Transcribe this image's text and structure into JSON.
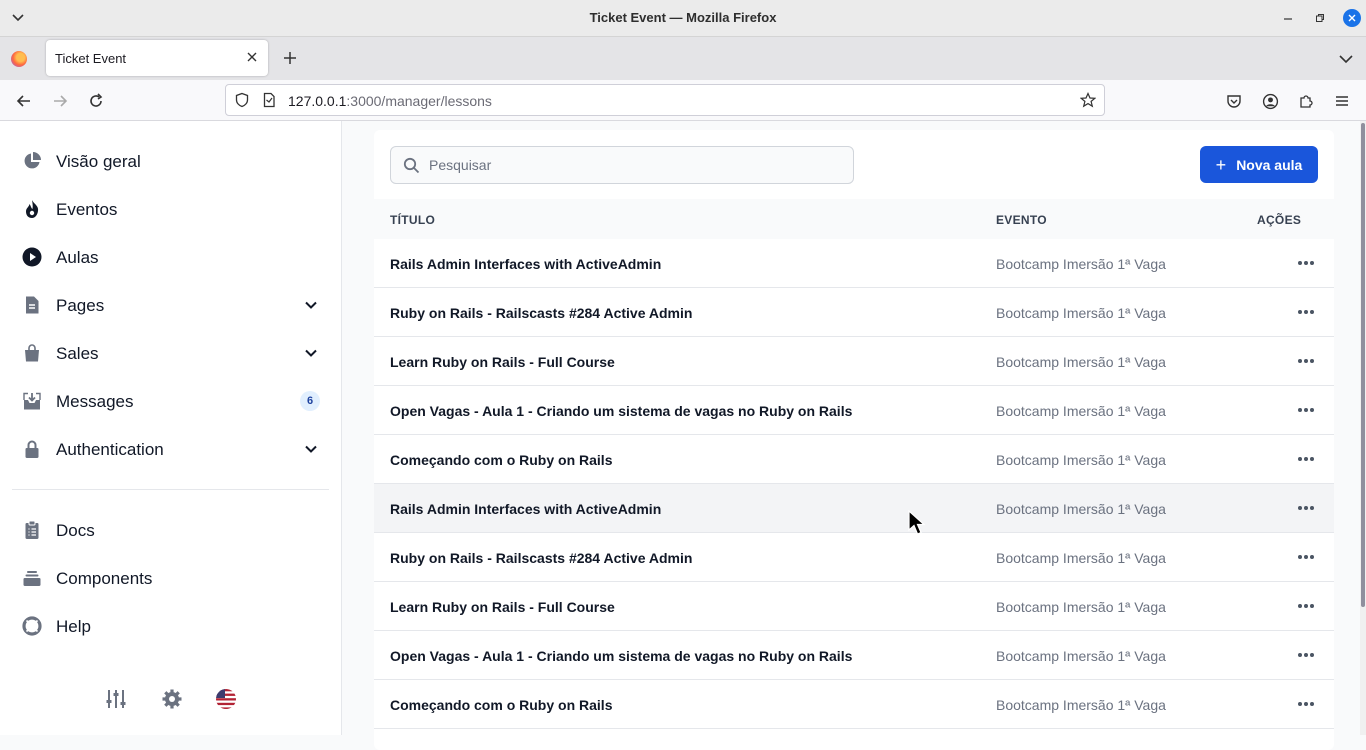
{
  "window": {
    "title": "Ticket Event — Mozilla Firefox"
  },
  "tab": {
    "title": "Ticket Event"
  },
  "urlbar": {
    "host": "127.0.0.1",
    "path": ":3000/manager/lessons"
  },
  "sidebar": {
    "items": [
      {
        "label": "Visão geral"
      },
      {
        "label": "Eventos"
      },
      {
        "label": "Aulas"
      },
      {
        "label": "Pages"
      },
      {
        "label": "Sales"
      },
      {
        "label": "Messages",
        "badge": "6"
      },
      {
        "label": "Authentication"
      }
    ],
    "secondary": [
      {
        "label": "Docs"
      },
      {
        "label": "Components"
      },
      {
        "label": "Help"
      }
    ]
  },
  "toolbar": {
    "search_placeholder": "Pesquisar",
    "new_button_label": "Nova aula"
  },
  "table": {
    "headers": {
      "title": "TÍTULO",
      "event": "EVENTO",
      "actions": "AÇÕES"
    },
    "rows": [
      {
        "title": "Rails Admin Interfaces with ActiveAdmin",
        "event": "Bootcamp Imersão 1ª Vaga"
      },
      {
        "title": "Ruby on Rails - Railscasts #284 Active Admin",
        "event": "Bootcamp Imersão 1ª Vaga"
      },
      {
        "title": "Learn Ruby on Rails - Full Course",
        "event": "Bootcamp Imersão 1ª Vaga"
      },
      {
        "title": "Open Vagas - Aula 1 - Criando um sistema de vagas no Ruby on Rails",
        "event": "Bootcamp Imersão 1ª Vaga"
      },
      {
        "title": "Começando com o Ruby on Rails",
        "event": "Bootcamp Imersão 1ª Vaga"
      },
      {
        "title": "Rails Admin Interfaces with ActiveAdmin",
        "event": "Bootcamp Imersão 1ª Vaga"
      },
      {
        "title": "Ruby on Rails - Railscasts #284 Active Admin",
        "event": "Bootcamp Imersão 1ª Vaga"
      },
      {
        "title": "Learn Ruby on Rails - Full Course",
        "event": "Bootcamp Imersão 1ª Vaga"
      },
      {
        "title": "Open Vagas - Aula 1 - Criando um sistema de vagas no Ruby on Rails",
        "event": "Bootcamp Imersão 1ª Vaga"
      },
      {
        "title": "Começando com o Ruby on Rails",
        "event": "Bootcamp Imersão 1ª Vaga"
      }
    ]
  },
  "colors": {
    "accent": "#1a56db",
    "badge_bg": "#e1effe",
    "badge_text": "#1e429f"
  }
}
